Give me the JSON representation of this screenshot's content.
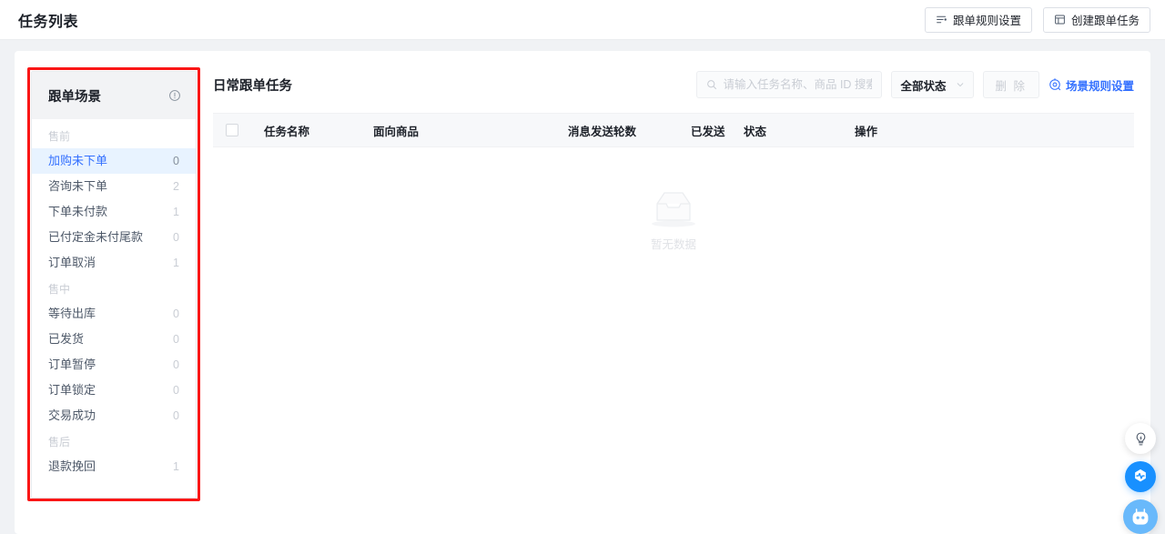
{
  "header": {
    "title": "任务列表",
    "buttons": [
      {
        "label": "跟单规则设置",
        "icon": "sliders-icon"
      },
      {
        "label": "创建跟单任务",
        "icon": "form-table-icon"
      }
    ]
  },
  "sidebar": {
    "title": "跟单场景",
    "info_icon": "info-circle-icon",
    "groups": [
      {
        "label": "售前",
        "items": [
          {
            "label": "加购未下单",
            "count": "0",
            "active": true
          },
          {
            "label": "咨询未下单",
            "count": "2",
            "active": false
          },
          {
            "label": "下单未付款",
            "count": "1",
            "active": false
          },
          {
            "label": "已付定金未付尾款",
            "count": "0",
            "active": false
          },
          {
            "label": "订单取消",
            "count": "1",
            "active": false
          }
        ]
      },
      {
        "label": "售中",
        "items": [
          {
            "label": "等待出库",
            "count": "0",
            "active": false
          },
          {
            "label": "已发货",
            "count": "0",
            "active": false
          },
          {
            "label": "订单暂停",
            "count": "0",
            "active": false
          },
          {
            "label": "订单锁定",
            "count": "0",
            "active": false
          },
          {
            "label": "交易成功",
            "count": "0",
            "active": false
          }
        ]
      },
      {
        "label": "售后",
        "items": [
          {
            "label": "退款挽回",
            "count": "1",
            "active": false
          }
        ]
      }
    ]
  },
  "main": {
    "title": "日常跟单任务",
    "search": {
      "placeholder": "请输入任务名称、商品 ID 搜索",
      "value": "",
      "icon": "search-icon"
    },
    "status_filter": {
      "label": "全部状态",
      "icon": "chevron-down-icon"
    },
    "delete_button": {
      "label": "删 除",
      "disabled": true
    },
    "rule_link": {
      "label": "场景规则设置",
      "icon": "target-gear-icon"
    },
    "table": {
      "columns": [
        "任务名称",
        "面向商品",
        "消息发送轮数",
        "已发送",
        "状态",
        "操作"
      ],
      "rows": [],
      "empty_text": "暂无数据",
      "empty_icon": "empty-inbox-icon"
    }
  },
  "floating": [
    {
      "name": "lightbulb-icon",
      "label": ""
    },
    {
      "name": "pulse-icon",
      "label": ""
    },
    {
      "name": "robot-assistant-icon",
      "label": ""
    }
  ],
  "colors": {
    "accent": "#3370ff",
    "annotation": "#fa1616",
    "page_bg": "#f0f2f5",
    "active_item_bg": "#e8f3ff"
  }
}
